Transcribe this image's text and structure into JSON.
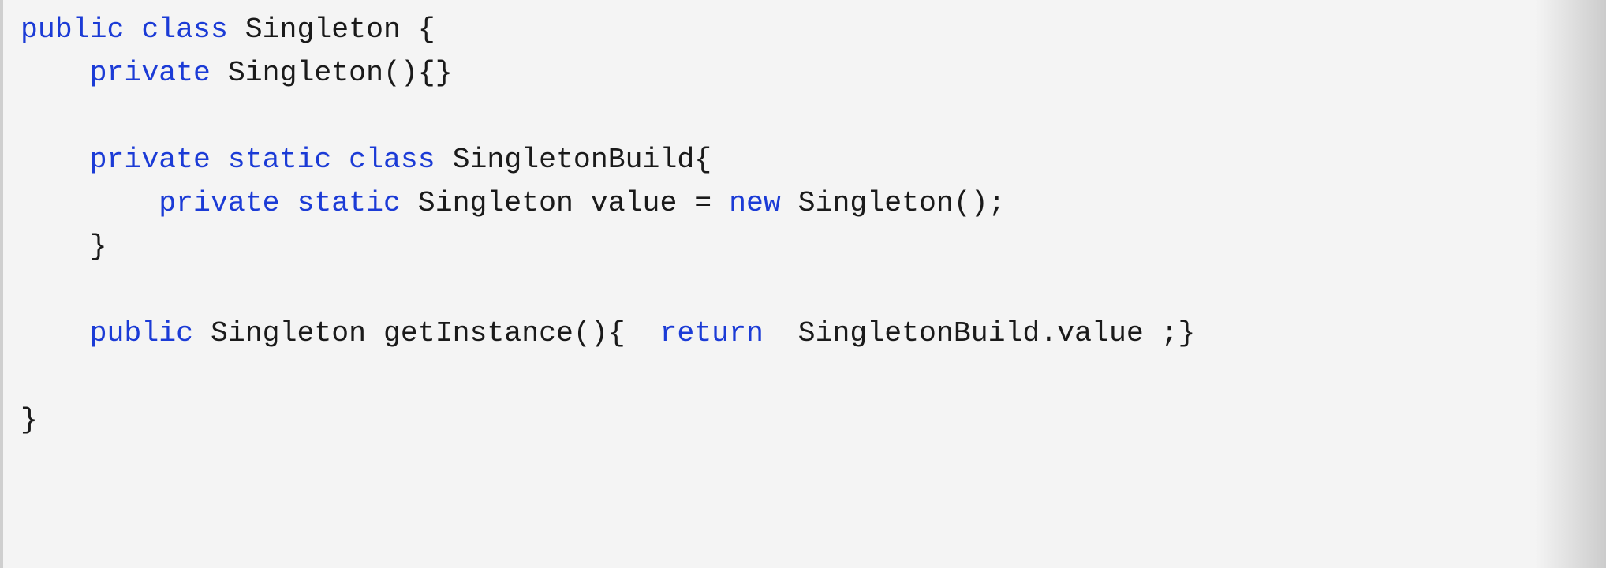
{
  "code": {
    "language": "java",
    "colors": {
      "keyword": "#1b3bd6",
      "text": "#1a1a1a",
      "background": "#f4f4f4"
    },
    "lines": [
      [
        {
          "t": "kw",
          "v": "public class"
        },
        {
          "t": "tx",
          "v": " Singleton {"
        }
      ],
      [
        {
          "t": "tx",
          "v": "    "
        },
        {
          "t": "kw",
          "v": "private"
        },
        {
          "t": "tx",
          "v": " Singleton(){}"
        }
      ],
      [
        {
          "t": "tx",
          "v": ""
        }
      ],
      [
        {
          "t": "tx",
          "v": "    "
        },
        {
          "t": "kw",
          "v": "private static class"
        },
        {
          "t": "tx",
          "v": " SingletonBuild{"
        }
      ],
      [
        {
          "t": "tx",
          "v": "        "
        },
        {
          "t": "kw",
          "v": "private static"
        },
        {
          "t": "tx",
          "v": " Singleton value = "
        },
        {
          "t": "kw",
          "v": "new"
        },
        {
          "t": "tx",
          "v": " Singleton();"
        }
      ],
      [
        {
          "t": "tx",
          "v": "    }"
        }
      ],
      [
        {
          "t": "tx",
          "v": ""
        }
      ],
      [
        {
          "t": "tx",
          "v": "    "
        },
        {
          "t": "kw",
          "v": "public"
        },
        {
          "t": "tx",
          "v": " Singleton getInstance(){  "
        },
        {
          "t": "kw",
          "v": "return"
        },
        {
          "t": "tx",
          "v": "  SingletonBuild.value ;}"
        }
      ],
      [
        {
          "t": "tx",
          "v": ""
        }
      ],
      [
        {
          "t": "tx",
          "v": "}"
        }
      ]
    ]
  }
}
